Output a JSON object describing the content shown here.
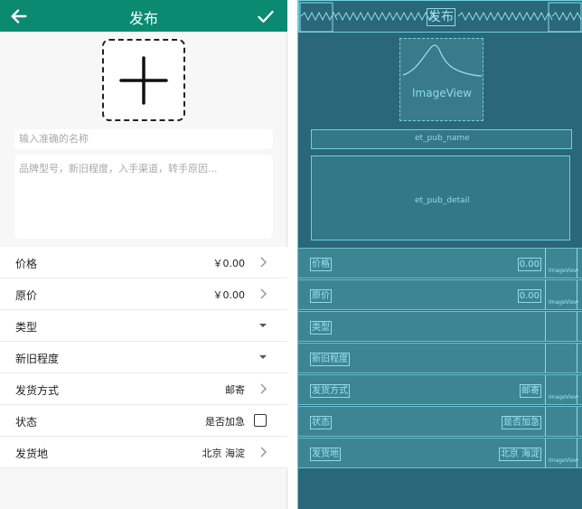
{
  "toolbar": {
    "title": "发布",
    "back_icon": "arrow-back-icon",
    "confirm_icon": "check-icon",
    "color": "#0b8a71"
  },
  "add_image_icon": "plus-icon",
  "name_input": {
    "placeholder": "输入准确的名称",
    "value": ""
  },
  "detail_input": {
    "placeholder": "品牌型号，新旧程度，入手渠道，转手原因...",
    "value": ""
  },
  "rows": [
    {
      "label": "价格",
      "value": "￥0.00",
      "control": "chevron"
    },
    {
      "label": "原价",
      "value": "￥0.00",
      "control": "chevron"
    },
    {
      "label": "类型",
      "value": "",
      "control": "dropdown"
    },
    {
      "label": "新旧程度",
      "value": "",
      "control": "dropdown"
    },
    {
      "label": "发货方式",
      "value": "邮寄",
      "control": "chevron"
    },
    {
      "label": "状态",
      "value": "是否加急",
      "control": "checkbox",
      "checked": false
    },
    {
      "label": "发货地",
      "value": "北京 海淀",
      "control": "chevron"
    }
  ],
  "blueprint": {
    "title": "发布",
    "image_view": "ImageView",
    "name_id": "et_pub_name",
    "detail_id": "et_pub_detail",
    "imageview_small": "ImageView",
    "row_labels": [
      "价格",
      "原价",
      "类型",
      "新旧程度",
      "发货方式",
      "状态",
      "发货地"
    ],
    "row_values": [
      "0.00",
      "0.00",
      "",
      "",
      "邮寄",
      "是否加急",
      "北京 海淀"
    ],
    "background": "#2a6778",
    "line_color": "#6fd2e2"
  }
}
